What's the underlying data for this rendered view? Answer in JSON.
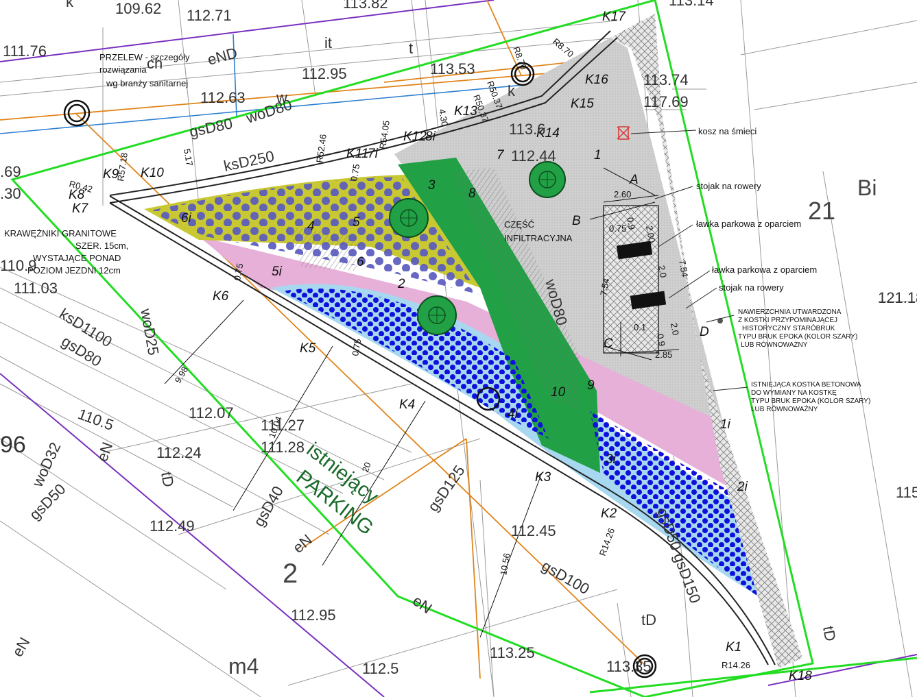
{
  "colors": {
    "boundary": "#22dd22",
    "pink": "#e6b0d8",
    "olive": "#c8c832",
    "green": "#21a046",
    "lightblue": "#a7d8f0",
    "grey": "#c8c8c8",
    "dots_purple": "#5a5abf",
    "dots_blue": "#1010dd",
    "orange": "#e0841a",
    "blue": "#2e7fd0",
    "purple": "#7a2fbf",
    "red": "#c03030"
  },
  "notes": {
    "przelew_1": "PRZELEW - szczegóły",
    "przelew_2": "rozwiązania",
    "przelew_3": "wg branży sanitarnej",
    "kraw_1": "KRAWĘŻNIKI GRANITOWE",
    "kraw_2": "SZER. 15cm,",
    "kraw_3": "WYSTAJĄCE PONAD",
    "kraw_4": "POZIOM JEZDNI 12cm",
    "infil_1": "CZĘŚĆ",
    "infil_2": "INFILTRACYJNA",
    "parking_1": "istniejący",
    "parking_2": "PARKING"
  },
  "legend": {
    "kosz": "kosz na śmieci",
    "stojak1": "stojak na rowery",
    "lawka1": "ławka parkowa z oparciem",
    "lawka2": "ławka parkowa z oparciem",
    "stojak2": "stojak na rowery",
    "naw_1": "NAWIERZCHNIA UTWARDZONA",
    "naw_2": "Z KOSTKI PRZYPOMINAJĄCEJ",
    "naw_3": "HISTORYCZNY STARÓBRUK",
    "naw_4": "TYPU BRUK EPOKA (KOLOR SZARY)",
    "naw_5": "LUB RÓWNOWAŻNY",
    "ist_1": "ISTNIEJĄCA KOSTKA BETONOWA",
    "ist_2": "DO WYMIANY NA KOSTKĘ",
    "ist_3": "TYPU BRUK EPOKA (KOLOR SZARY)",
    "ist_4": "LUB RÓWNOWAŻNY"
  },
  "points": {
    "K1": "K1",
    "K2": "K2",
    "K3": "K3",
    "K4": "K4",
    "K5": "K5",
    "K6": "K6",
    "K7": "K7",
    "K8": "K8",
    "K9": "K9",
    "K10": "K10",
    "K11": "K11",
    "K12": "K12",
    "K13": "K13",
    "K14": "K14",
    "K15": "K15",
    "K16": "K16",
    "K17": "K17",
    "K18": "K18",
    "A": "A",
    "B": "B",
    "C": "C",
    "D": "D"
  },
  "zones": {
    "z1": "1",
    "z2": "2",
    "z3": "3",
    "z4": "4",
    "z5": "5",
    "z6": "6",
    "z7": "7",
    "z8": "8",
    "z9": "9",
    "z10": "10",
    "z1i": "1i",
    "z2i": "2i",
    "z3i": "3i",
    "z4i": "4i",
    "z5i": "5i",
    "z6i": "6i",
    "z7i": "7i",
    "z8i": "8i"
  },
  "dims": {
    "d260": "2.60",
    "d200": "2.00",
    "d075a": "0.75",
    "d09a": "0.9",
    "d20a": "2.0",
    "d754a": "7.54",
    "d754b": "7.54",
    "d20b": "2.0",
    "d09b": "0.9",
    "d01": "0.1",
    "d285": "2.85",
    "d998": "9.98",
    "d1004": "10.04",
    "d1056": "10.56",
    "d075b": "0.75",
    "d075c": "0.75",
    "d075d": "0.75",
    "d430": "4.30",
    "r5718": "R57.18",
    "r042": "R0.42",
    "r5246": "R52.46",
    "r5405": "R54.05",
    "r5037a": "R50.37",
    "r5037b": "R50.37",
    "r870a": "R8.70",
    "r870b": "R8.70",
    "r1426a": "R14.26",
    "r1426b": "R14.26",
    "d517": "5.17",
    "d20c": "20"
  },
  "elevations": {
    "e1": "109.62",
    "e2": "112.71",
    "e3": "113.82",
    "e4": "113.14",
    "e5": "111.76",
    "e6": "112.95",
    "e7": "113.53",
    "e8": "112.63",
    "e9": "113.74",
    "e10": "117.69",
    "e11": "113.6",
    "e12": "112.44",
    "e13": "110.9",
    "e14": "111.03",
    "e15": "112.07",
    "e16": "111.27",
    "e17": "111.28",
    "e18": "112.24",
    "e19": "110.5",
    "e20": "112.49",
    "e21": "112.45",
    "e22": "112.95",
    "e23": "113.25",
    "e24": "112.5",
    "e25": "113.35",
    "e26": "121.18",
    "e27": "115",
    "e28": ".69",
    "e29": ".30",
    "e30": "96"
  },
  "pipes": {
    "p1": "ksD250",
    "p2": "gsD80",
    "p3": "woD80",
    "p4": "woD25",
    "p5": "ksD1100",
    "p6": "gsD80",
    "p7": "woD32",
    "p8": "gsD50",
    "p9": "gsD40",
    "p10": "gsD125",
    "p11": "gsD100",
    "p12": "gsD50 gsD150",
    "p13": "woD80",
    "p14": "eND",
    "p15": "eN",
    "p16": "eN",
    "p17": "eN",
    "p18": "tD",
    "p19": "tD",
    "p20": "tD",
    "p21": "w",
    "p22": "it",
    "p23": "t",
    "p24": "k",
    "p25": "ch",
    "p26": "eN",
    "p27": "k"
  },
  "parcels": {
    "n21": "21",
    "bi": "Bi",
    "n2": "2",
    "m4": "m4"
  }
}
